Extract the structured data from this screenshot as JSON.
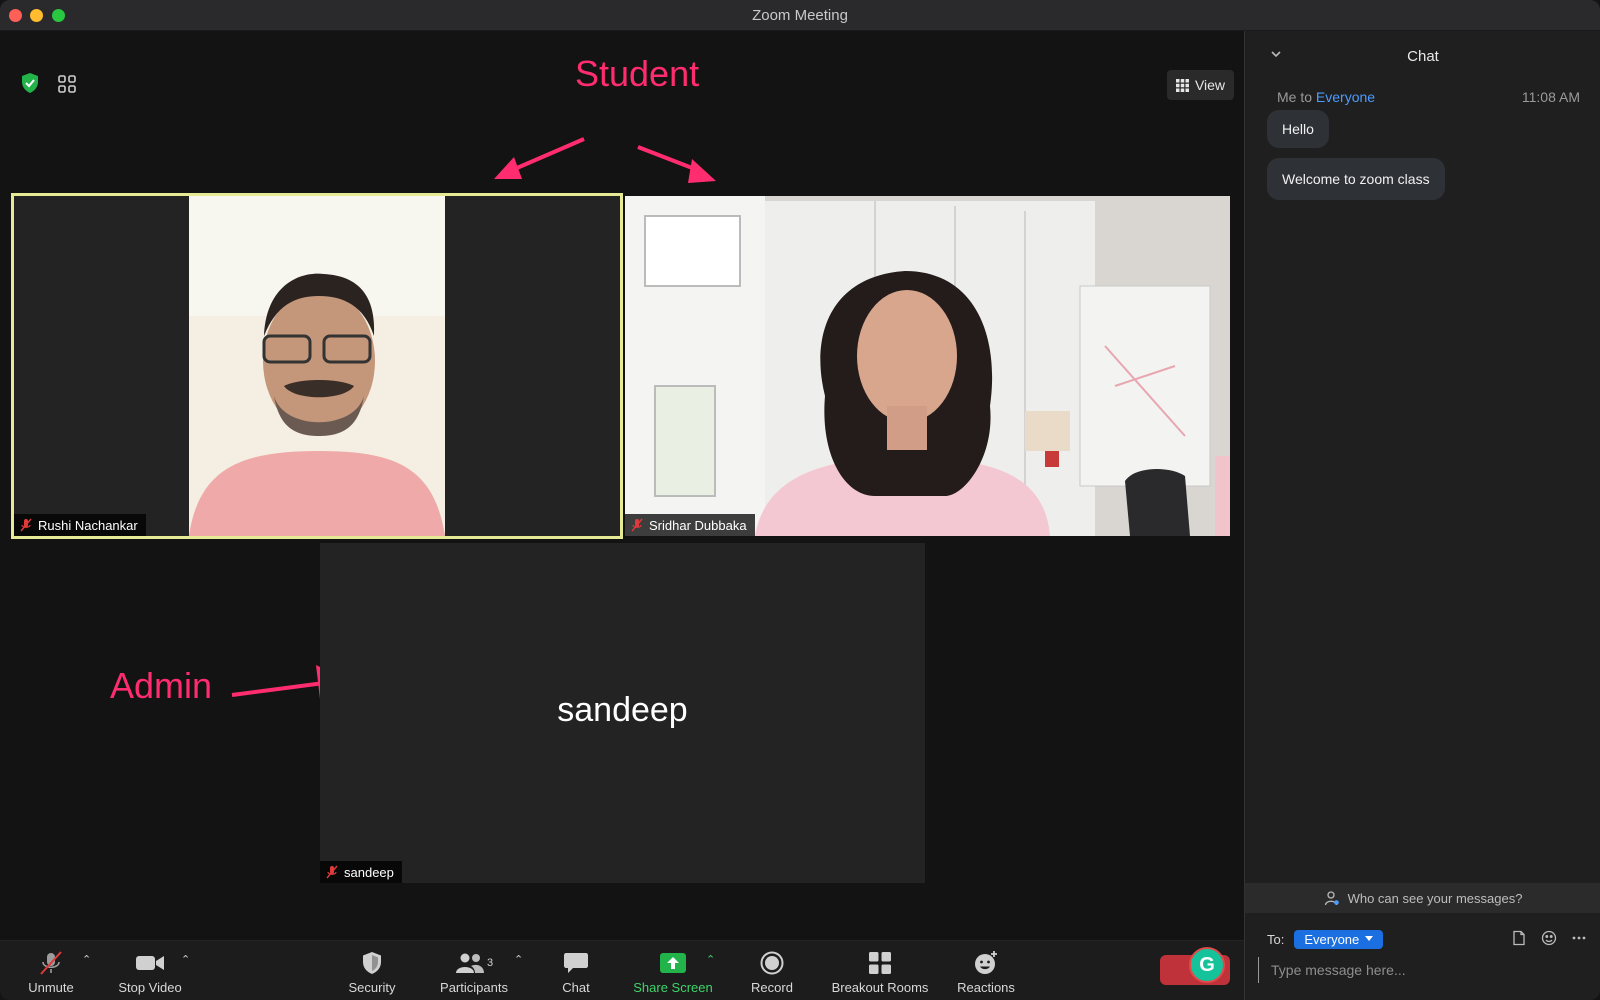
{
  "window": {
    "title": "Zoom Meeting"
  },
  "stage": {
    "view_label": "View"
  },
  "annotations": {
    "student": "Student",
    "admin": "Admin"
  },
  "participants": [
    {
      "name": "Rushi Nachankar",
      "muted": true,
      "active_speaker": true
    },
    {
      "name": "Sridhar Dubbaka",
      "muted": true,
      "active_speaker": false
    },
    {
      "name": "sandeep",
      "muted": true,
      "video_off": true,
      "display_name": "sandeep"
    }
  ],
  "chat": {
    "title": "Chat",
    "sender": "Me to",
    "recipient": "Everyone",
    "time": "11:08 AM",
    "messages": [
      "Hello",
      "Welcome to zoom class"
    ],
    "who_can_see": "Who can see your messages?",
    "to_label": "To:",
    "to_value": "Everyone",
    "input_placeholder": "Type message here..."
  },
  "toolbar": {
    "unmute": "Unmute",
    "stop_video": "Stop Video",
    "security": "Security",
    "participants": "Participants",
    "participants_count": "3",
    "chat": "Chat",
    "share_screen": "Share Screen",
    "record": "Record",
    "breakout_rooms": "Breakout Rooms",
    "reactions": "Reactions"
  },
  "colors": {
    "annotation": "#ff2d6f",
    "active_speaker_border": "#e7ea94",
    "share_green": "#3fd46a",
    "link_blue": "#4a9cff",
    "chip_blue": "#1b6fe0"
  }
}
